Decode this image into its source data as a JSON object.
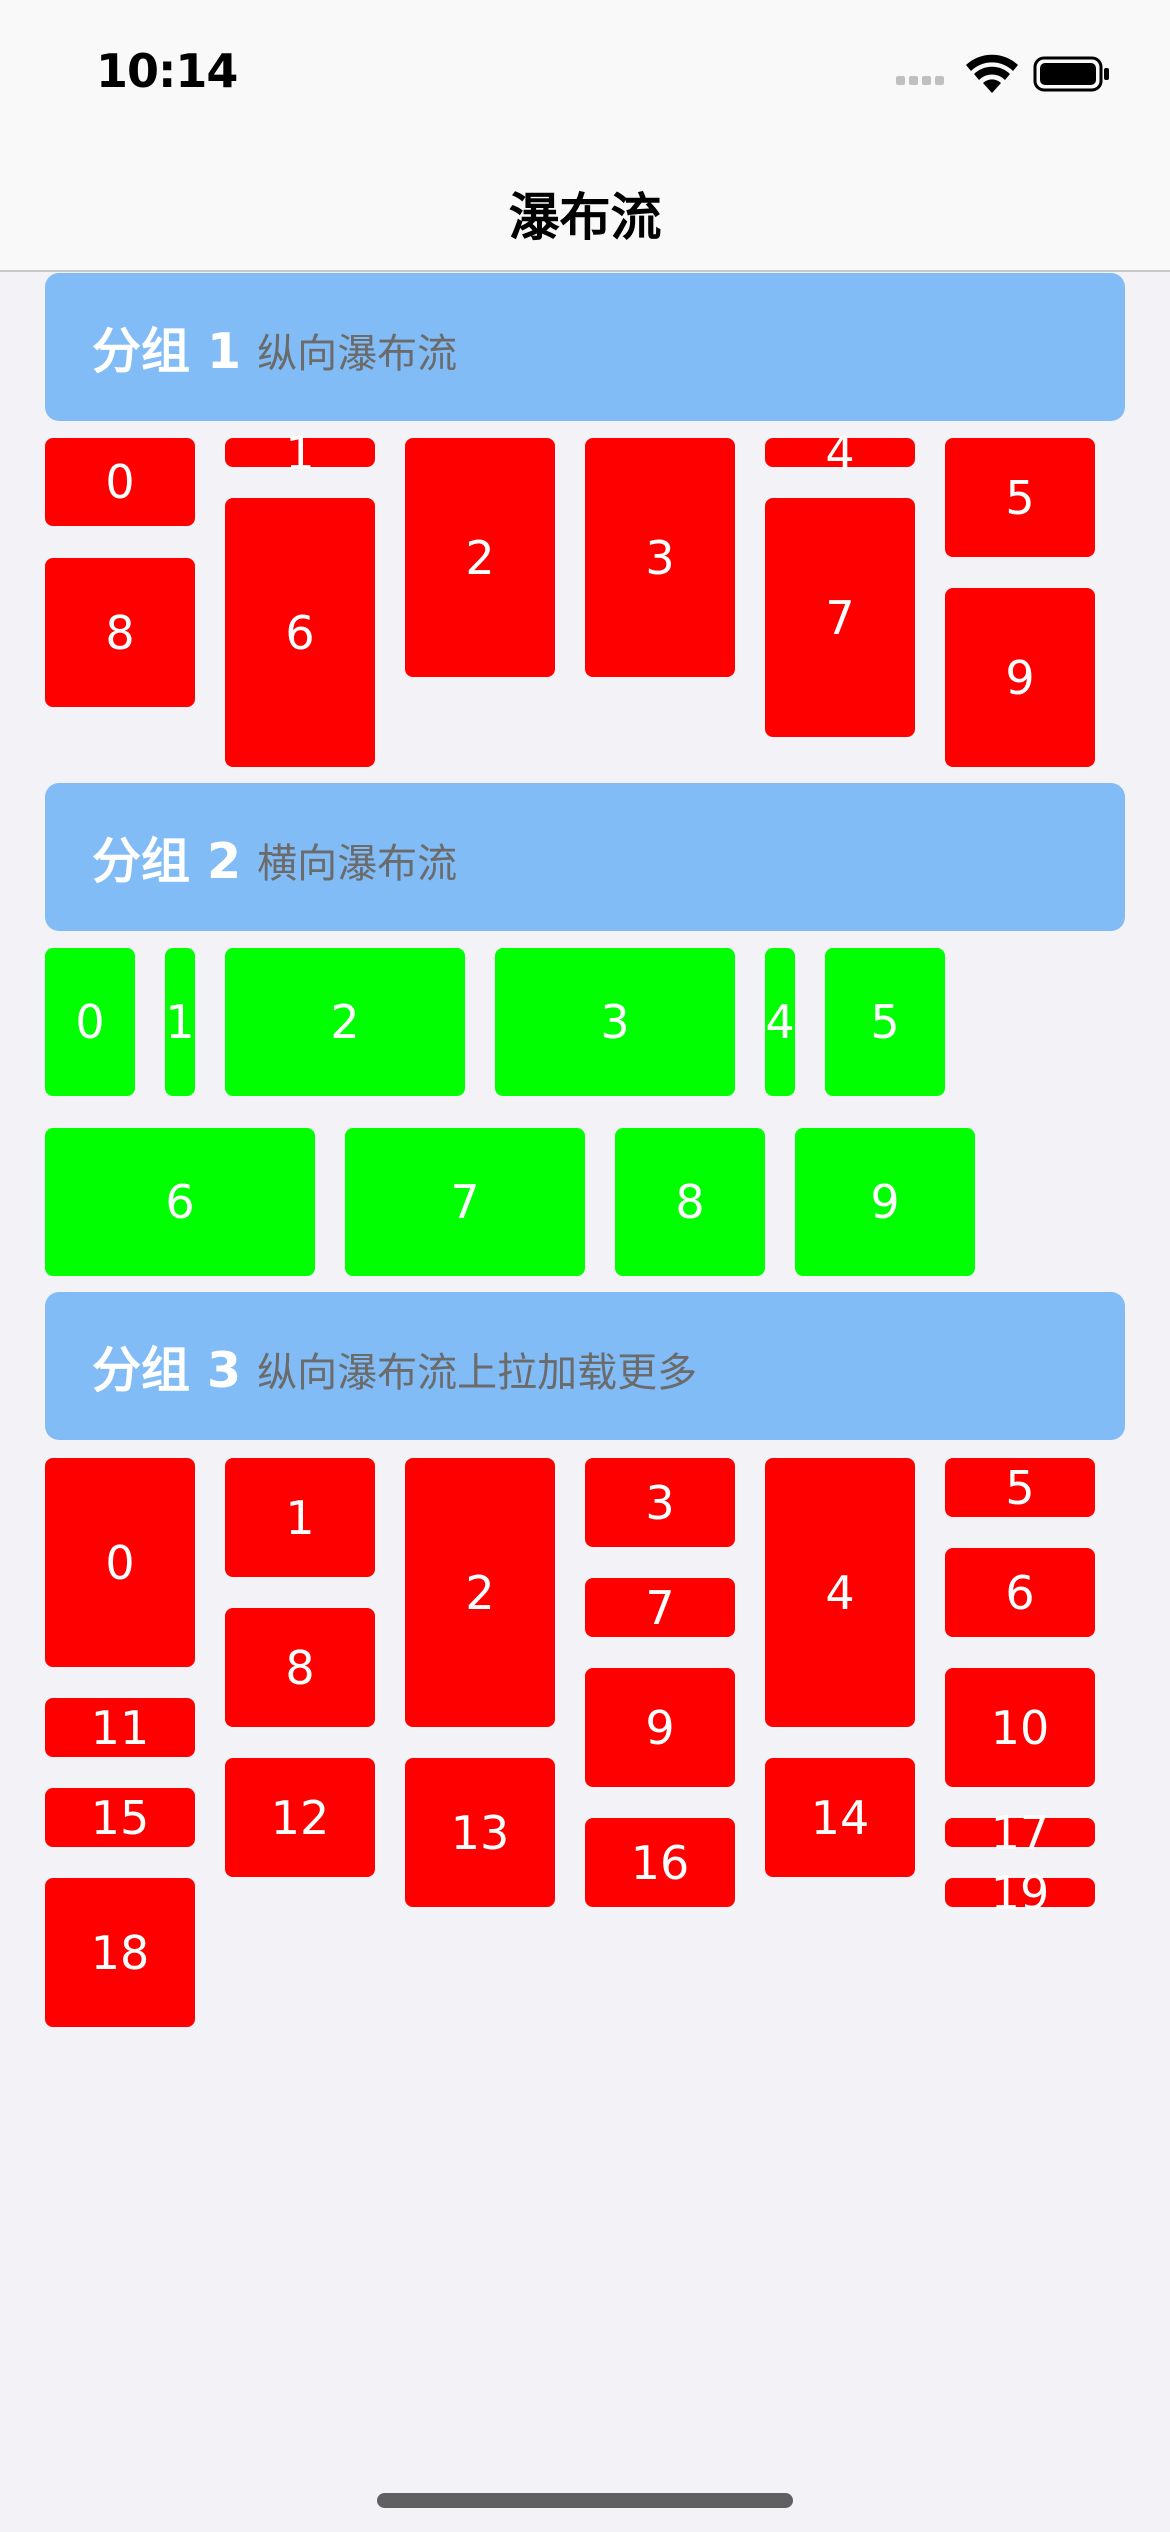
{
  "status_bar": {
    "time": "10:14"
  },
  "nav": {
    "title": "瀑布流"
  },
  "sections": [
    {
      "title": "分组 1",
      "subtitle": "纵向瀑布流",
      "color": "#ff0000",
      "items": [
        "0",
        "1",
        "2",
        "3",
        "4",
        "5",
        "6",
        "7",
        "8",
        "9"
      ]
    },
    {
      "title": "分组 2",
      "subtitle": "横向瀑布流",
      "color": "#00ff00",
      "items": [
        "0",
        "1",
        "2",
        "3",
        "4",
        "5",
        "6",
        "7",
        "8",
        "9"
      ]
    },
    {
      "title": "分组 3",
      "subtitle": "纵向瀑布流上拉加载更多",
      "color": "#ff0000",
      "items": [
        "0",
        "1",
        "2",
        "3",
        "4",
        "5",
        "6",
        "7",
        "8",
        "9",
        "10",
        "11",
        "12",
        "13",
        "14",
        "15",
        "16",
        "17",
        "18",
        "19"
      ]
    }
  ],
  "colors": {
    "header_bg": "#82bcf6",
    "page_bg": "#f2f2f7"
  }
}
